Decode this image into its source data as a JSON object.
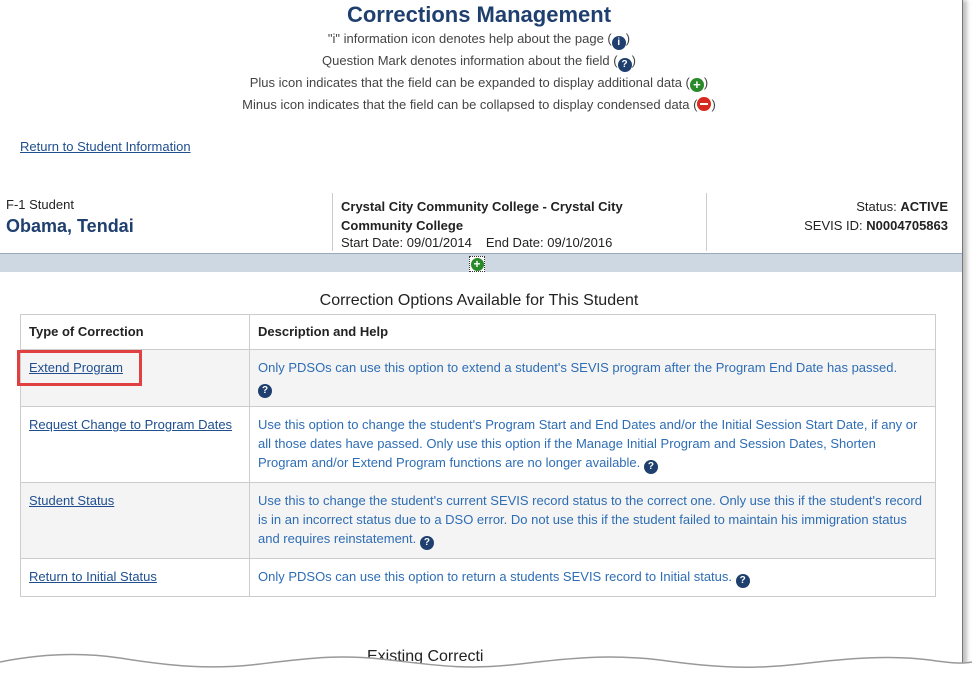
{
  "header": {
    "title": "Corrections Management",
    "legend": [
      {
        "text_before": "\"i\" information icon denotes help about the page (",
        "text_after": ")",
        "icon": "info-icon"
      },
      {
        "text_before": "Question Mark denotes information about the field (",
        "text_after": ")",
        "icon": "question-icon"
      },
      {
        "text_before": "Plus icon indicates that the field can be expanded to display additional data (",
        "text_after": ")",
        "icon": "plus-icon"
      },
      {
        "text_before": "Minus icon indicates that the field can be collapsed to display condensed data (",
        "text_after": ")",
        "icon": "minus-icon"
      }
    ]
  },
  "return_link": "Return to Student Information",
  "student": {
    "type": "F-1 Student",
    "name": "Obama, Tendai",
    "school": "Crystal City Community College - Crystal City Community College",
    "start_date": "Start Date: 09/01/2014",
    "end_date": "End Date: 09/10/2016",
    "status_label": "Status:",
    "status_value": "ACTIVE",
    "sevis_label": "SEVIS ID:",
    "sevis_value": "N0004705863"
  },
  "options": {
    "title": "Correction Options Available for This Student",
    "columns": [
      "Type of Correction",
      "Description and Help"
    ],
    "rows": [
      {
        "type": "Extend Program",
        "desc": "Only PDSOs can use this option to extend a student's SEVIS program after the Program End Date has passed."
      },
      {
        "type": "Request Change to Program Dates",
        "desc": "Use this option to change the student's Program Start and End Dates and/or the Initial Session Start Date, if any or all those dates have passed. Only use this option if the Manage Initial Program and Session Dates, Shorten Program and/or Extend Program functions are no longer available."
      },
      {
        "type": "Student Status",
        "desc": "Use this to change the student's current SEVIS record status to the correct one. Only use this if the student's record is in an incorrect status due to a DSO error. Do not use this if the student failed to maintain his immigration status and requires reinstatement."
      },
      {
        "type": "Return to Initial Status",
        "desc": "Only PDSOs can use this option to return a students SEVIS record to Initial status."
      }
    ]
  },
  "existing_title": "Existing Correcti",
  "colors": {
    "accent": "#1f3f6f",
    "link": "#1f4f8f",
    "desc": "#2e6db4",
    "highlight": "#e04040"
  }
}
